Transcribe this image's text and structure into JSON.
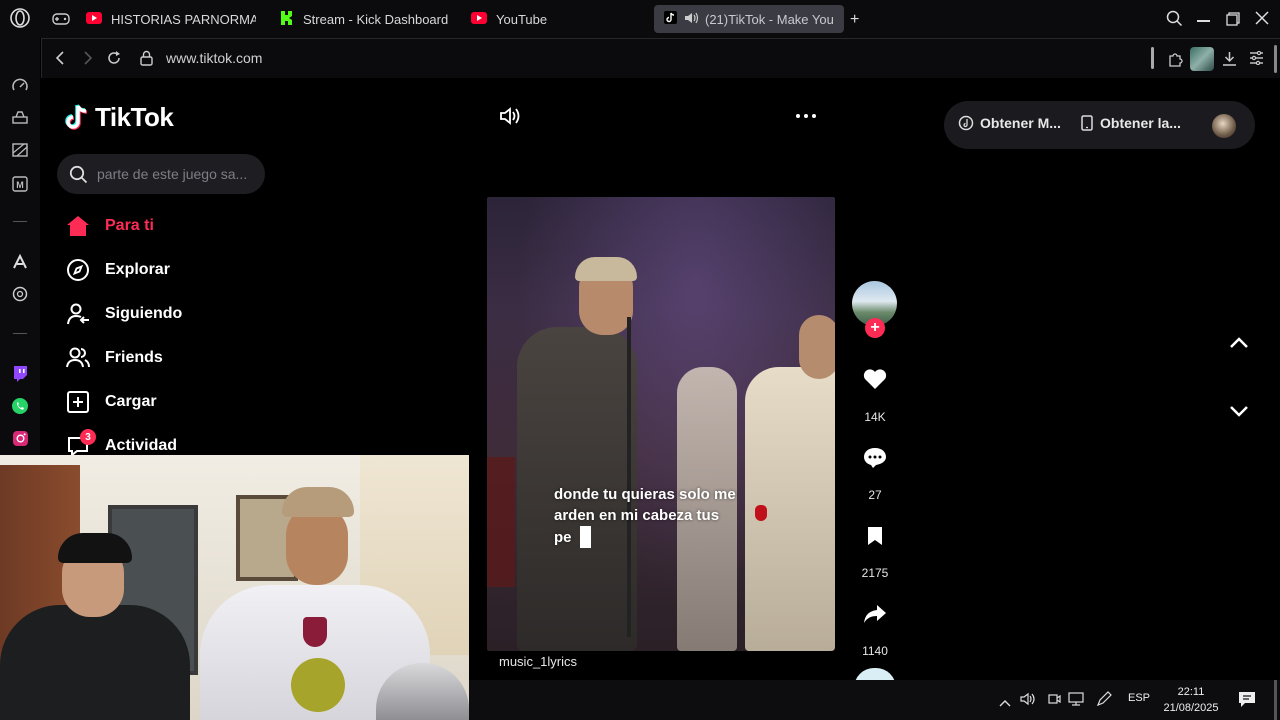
{
  "browser": {
    "tabs": [
      {
        "label": "HISTORIAS PARNORMALE",
        "icon": "youtube-icon"
      },
      {
        "label": "Stream - Kick Dashboard",
        "icon": "kick-icon"
      },
      {
        "label": "YouTube",
        "icon": "youtube-icon"
      },
      {
        "label": "(21)TikTok - Make You",
        "icon": "tiktok-icon",
        "active": true
      }
    ],
    "url": "www.tiktok.com"
  },
  "tiktok": {
    "logo_text": "TikTok",
    "search_placeholder": "parte de este juego sa...",
    "nav": [
      {
        "label": "Para ti",
        "icon": "home-icon",
        "active": true
      },
      {
        "label": "Explorar",
        "icon": "compass-icon"
      },
      {
        "label": "Siguiendo",
        "icon": "following-icon"
      },
      {
        "label": "Friends",
        "icon": "friends-icon"
      },
      {
        "label": "Cargar",
        "icon": "upload-icon"
      },
      {
        "label": "Actividad",
        "icon": "activity-icon",
        "badge": "3"
      }
    ],
    "top_buttons": {
      "get_coins": "Obtener M...",
      "get_app": "Obtener la..."
    },
    "video": {
      "caption_lines": [
        "donde tu quieras solo me",
        "arden en mi cabeza tus",
        "pe"
      ],
      "author": "music_1lyrics"
    },
    "actions": {
      "likes": "14K",
      "comments": "27",
      "saves": "2175",
      "shares": "1140"
    }
  },
  "taskbar": {
    "language": "ESP",
    "time": "22:11",
    "date": "21/08/2025"
  },
  "colors": {
    "tiktok_red": "#fe2c55",
    "background": "#000000",
    "tab_active": "#3b3b43"
  }
}
